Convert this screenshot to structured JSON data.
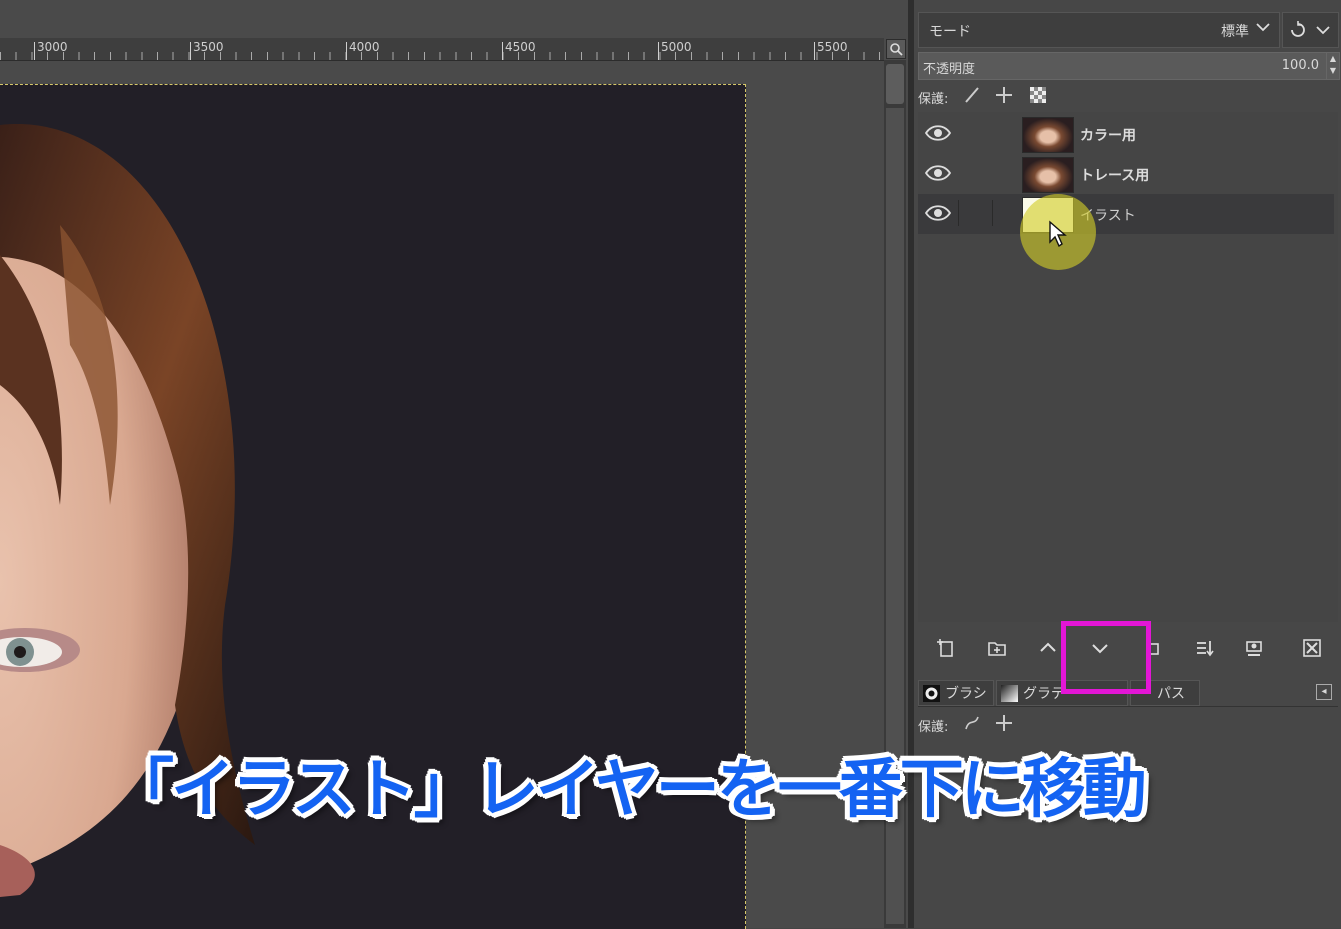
{
  "ruler": {
    "labels": [
      "3000",
      "3500",
      "4000",
      "4500",
      "5000",
      "5500"
    ]
  },
  "layers_panel": {
    "mode_label": "モード",
    "mode_value": "標準",
    "opacity_label": "不透明度",
    "opacity_value": "100.0",
    "lock_label": "保護:",
    "layers": [
      {
        "name": "カラー用",
        "visible": true,
        "thumbnail": "photo"
      },
      {
        "name": "トレース用",
        "visible": true,
        "thumbnail": "photo"
      },
      {
        "name": "イラスト",
        "visible": true,
        "thumbnail": "white",
        "selected": true
      }
    ],
    "toolbar_icons": [
      "new-layer-icon",
      "new-layer-group-icon",
      "raise-layer-icon",
      "lower-layer-icon",
      "duplicate-layer-icon",
      "merge-down-icon",
      "add-mask-icon",
      "delete-layer-icon"
    ]
  },
  "bottom_tabs": {
    "tabs": [
      {
        "label": "ブラシ"
      },
      {
        "label": "グラデ"
      },
      {
        "label": "パス"
      }
    ],
    "lock_label": "保護:"
  },
  "caption": "「イラスト」レイヤーを一番下に移動",
  "colors": {
    "highlight_box": "#e316d6",
    "caption_text": "#1463f2",
    "cursor_highlight": "#d2cd28"
  }
}
